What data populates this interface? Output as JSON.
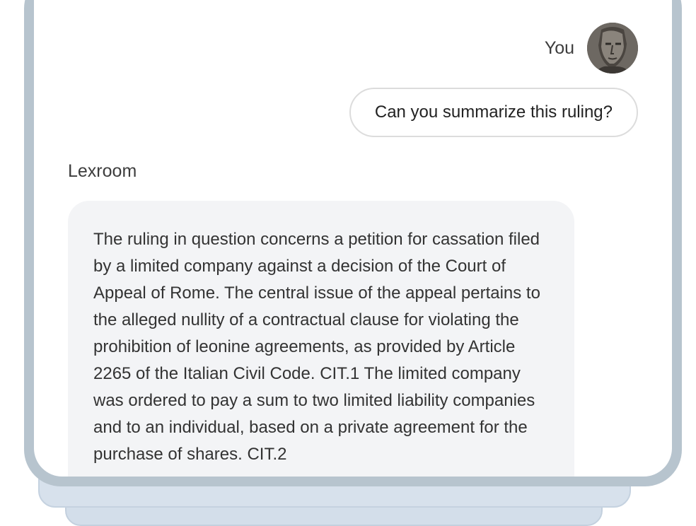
{
  "chat": {
    "user": {
      "name": "You",
      "avatar_icon": "user-avatar-portrait",
      "message": "Can you summarize this ruling?"
    },
    "assistant": {
      "name": "Lexroom",
      "message": "The ruling in question concerns a petition for cassation filed by a limited company against a decision of the Court of Appeal of Rome. The central issue of the appeal pertains to the alleged nullity of a contractual clause for violating the prohibition of leonine agreements, as provided by Article 2265 of the Italian Civil Code. CIT.1 The limited company was ordered to pay a sum to two limited liability companies and to an individual, based on a private agreement for the purchase of shares. CIT.2"
    }
  },
  "colors": {
    "device_frame": "#b7c4ce",
    "assistant_bubble": "#f3f4f6",
    "user_bubble_border": "#dcdcdc",
    "stack_card": "#d7e1ec"
  }
}
